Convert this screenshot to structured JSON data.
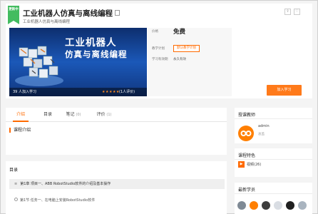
{
  "header": {
    "badge": "更新中",
    "title": "工业机器人仿真与离线编程",
    "subtitle": "工业机器人仿真与离线编程",
    "share_icon": "share-icon",
    "favorite_icon": "favorite-icon"
  },
  "cover": {
    "line1": "工业机器人",
    "line2": "仿真与离线编程",
    "learners": "39 人加入学习",
    "stars": "★★★★★",
    "rating": "(1人评价)"
  },
  "info": {
    "price_label": "价格",
    "price": "免费",
    "plan_label": "教学计划",
    "plan_value": "默认教学计划",
    "validity_label": "学习有效期",
    "validity": "永久有效",
    "join_button": "加入学习"
  },
  "tabs": [
    {
      "label": "介绍",
      "count": ""
    },
    {
      "label": "目录",
      "count": ""
    },
    {
      "label": "笔记",
      "count": "(0)"
    },
    {
      "label": "评价",
      "count": "(1)"
    }
  ],
  "intro": {
    "section_title": "课程介绍"
  },
  "directory": {
    "title": "目录",
    "chapter": "第1章  项目一、ABB RobotStudio软件的介绍及基本操作",
    "lesson": "第1节  任务一、在电脑上安装RobotStudio软件"
  },
  "teacher": {
    "title": "授课教师",
    "name": "admin",
    "role": "总监"
  },
  "features": {
    "title": "课程特色",
    "item": "视频(26)"
  },
  "students": {
    "title": "最新学员"
  },
  "colors": {
    "accent": "#ff6a00",
    "badge": "#43bc60",
    "cover_blue": "#1b58b8"
  }
}
